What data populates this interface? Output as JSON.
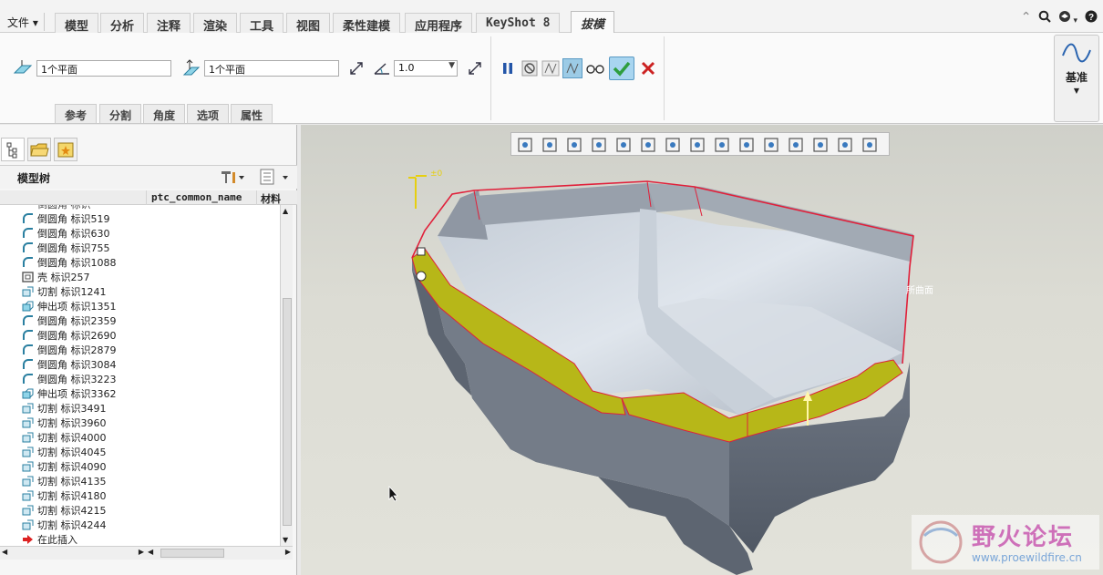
{
  "menubar": {
    "file_label": "文件",
    "tabs": [
      {
        "label": "模型"
      },
      {
        "label": "分析"
      },
      {
        "label": "注释"
      },
      {
        "label": "渲染"
      },
      {
        "label": "工具"
      },
      {
        "label": "视图"
      },
      {
        "label": "柔性建模"
      },
      {
        "label": "应用程序"
      },
      {
        "label": "KeyShot 8"
      },
      {
        "label": "拔模",
        "active": true
      }
    ],
    "right_icons": [
      "collapse-ribbon-icon",
      "search-icon",
      "community-icon",
      "help-icon"
    ]
  },
  "ribbon": {
    "draft_hinges_value": "1个平面",
    "pull_direction_value": "1个平面",
    "angle_value": "1.0",
    "subtabs": [
      "参考",
      "分割",
      "角度",
      "选项",
      "属性"
    ],
    "controls": [
      "pause-icon",
      "no-preview-icon",
      "preview-icon",
      "verify-icon",
      "glasses-icon",
      "confirm-icon",
      "cancel-icon"
    ],
    "datum_label": "基准",
    "accent_green": "#2e9e3e",
    "accent_red": "#cc2222"
  },
  "left_panel": {
    "tree_title": "模型树",
    "columns": [
      "ptc_common_name",
      "材料"
    ],
    "items": [
      {
        "icon": "round-icon",
        "label": "倒圆角 标识519"
      },
      {
        "icon": "round-icon",
        "label": "倒圆角 标识630"
      },
      {
        "icon": "round-icon",
        "label": "倒圆角 标识755"
      },
      {
        "icon": "round-icon",
        "label": "倒圆角 标识1088"
      },
      {
        "icon": "shell-icon",
        "label": "壳 标识257"
      },
      {
        "icon": "cut-icon",
        "label": "切割 标识1241"
      },
      {
        "icon": "extrude-icon",
        "label": "伸出项 标识1351"
      },
      {
        "icon": "round-icon",
        "label": "倒圆角 标识2359"
      },
      {
        "icon": "round-icon",
        "label": "倒圆角 标识2690"
      },
      {
        "icon": "round-icon",
        "label": "倒圆角 标识2879"
      },
      {
        "icon": "round-icon",
        "label": "倒圆角 标识3084"
      },
      {
        "icon": "round-icon",
        "label": "倒圆角 标识3223"
      },
      {
        "icon": "extrude-icon",
        "label": "伸出项 标识3362"
      },
      {
        "icon": "cut-icon",
        "label": "切割 标识3491"
      },
      {
        "icon": "cut-icon",
        "label": "切割 标识3960"
      },
      {
        "icon": "cut-icon",
        "label": "切割 标识4000"
      },
      {
        "icon": "cut-icon",
        "label": "切割 标识4045"
      },
      {
        "icon": "cut-icon",
        "label": "切割 标识4090"
      },
      {
        "icon": "cut-icon",
        "label": "切割 标识4135"
      },
      {
        "icon": "cut-icon",
        "label": "切割 标识4180"
      },
      {
        "icon": "cut-icon",
        "label": "切割 标识4215"
      },
      {
        "icon": "cut-icon",
        "label": "切割 标识4244"
      },
      {
        "icon": "insert-here-icon",
        "label": "在此插入"
      }
    ]
  },
  "viewport": {
    "angle_tag": "±0",
    "surface_label": "所曲面",
    "watermark_cn": "野火论坛",
    "watermark_url": "www.proewildfire.cn"
  }
}
